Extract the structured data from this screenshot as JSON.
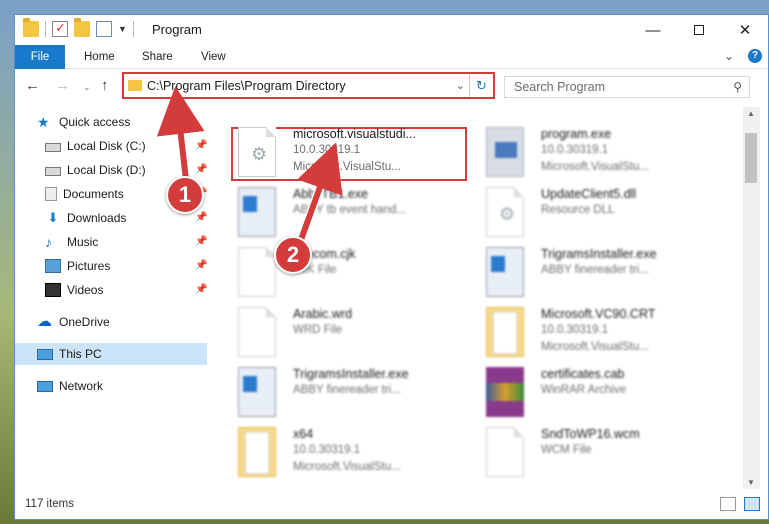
{
  "window": {
    "title": "Program",
    "controls": {
      "minimize": "—",
      "maximize": "",
      "close": "✕"
    }
  },
  "ribbon": {
    "tabs": [
      "File",
      "Home",
      "Share",
      "View"
    ],
    "expand_glyph": "⌄",
    "help_glyph": "?"
  },
  "nav": {
    "back": "←",
    "forward": "→",
    "recent": "⌄",
    "up": "↑"
  },
  "address": {
    "path": "C:\\Program Files\\Program Directory",
    "dropdown_glyph": "⌄",
    "refresh_glyph": "↻"
  },
  "search": {
    "placeholder": "Search Program",
    "icon_glyph": "⚲"
  },
  "sidebar": {
    "items": [
      {
        "label": "Quick access",
        "icon": "star-icon",
        "pinned": false
      },
      {
        "label": "Local Disk (C:)",
        "icon": "disk-icon",
        "pinned": true
      },
      {
        "label": "Local Disk (D:)",
        "icon": "disk-icon",
        "pinned": true
      },
      {
        "label": "Documents",
        "icon": "documents-icon",
        "pinned": true
      },
      {
        "label": "Downloads",
        "icon": "download-icon",
        "pinned": true
      },
      {
        "label": "Music",
        "icon": "music-icon",
        "pinned": true
      },
      {
        "label": "Pictures",
        "icon": "pictures-icon",
        "pinned": true
      },
      {
        "label": "Videos",
        "icon": "videos-icon",
        "pinned": true
      },
      {
        "label": "OneDrive",
        "icon": "onedrive-icon",
        "pinned": false
      },
      {
        "label": "This PC",
        "icon": "pc-icon",
        "pinned": false,
        "selected": true
      },
      {
        "label": "Network",
        "icon": "network-icon",
        "pinned": false
      }
    ],
    "pin_glyph": "📌"
  },
  "files": [
    {
      "name": "microsoft.visualstudi...",
      "line2": "10.0.30319.1",
      "line3": "Microsoft.VisualStu...",
      "icon": "dll-gear-icon"
    },
    {
      "name": "program.exe",
      "line2": "10.0.30319.1",
      "line3": "Microsoft.VisualStu...",
      "icon": "program-exe-icon"
    },
    {
      "name": "AbbyTB1.exe",
      "line2": "ABBY tb event hand...",
      "line3": "",
      "icon": "exe-icon"
    },
    {
      "name": "UpdateClient5.dll",
      "line2": "Resource DLL",
      "line3": "",
      "icon": "dll-gear-icon"
    },
    {
      "name": "Filecom.cjk",
      "line2": "CJK File",
      "line3": "",
      "icon": "page-icon"
    },
    {
      "name": "TrigramsInstaller.exe",
      "line2": "ABBY finereader tri...",
      "line3": "",
      "icon": "exe-icon"
    },
    {
      "name": "Arabic.wrd",
      "line2": "WRD File",
      "line3": "",
      "icon": "page-icon"
    },
    {
      "name": "Microsoft.VC90.CRT",
      "line2": "10.0.30319.1",
      "line3": "Microsoft.VisualStu...",
      "icon": "folder-doc-icon"
    },
    {
      "name": "TrigramsInstaller.exe",
      "line2": "ABBY finereader tri...",
      "line3": "",
      "icon": "exe-icon"
    },
    {
      "name": "certificates.cab",
      "line2": "WinRAR Archive",
      "line3": "",
      "icon": "winrar-icon"
    },
    {
      "name": "x64",
      "line2": "10.0.30319.1",
      "line3": "Microsoft.VisualStu...",
      "icon": "folder-doc-icon"
    },
    {
      "name": "SndToWP16.wcm",
      "line2": "WCM File",
      "line3": "",
      "icon": "page-icon"
    }
  ],
  "status": {
    "items_count": "117 items"
  },
  "annotations": {
    "step1": "1",
    "step2": "2",
    "accent": "#d43c3c"
  },
  "colors": {
    "file_tab": "#1979ca",
    "selected_nav": "#cce4f7",
    "highlight": "#d43c3c"
  }
}
